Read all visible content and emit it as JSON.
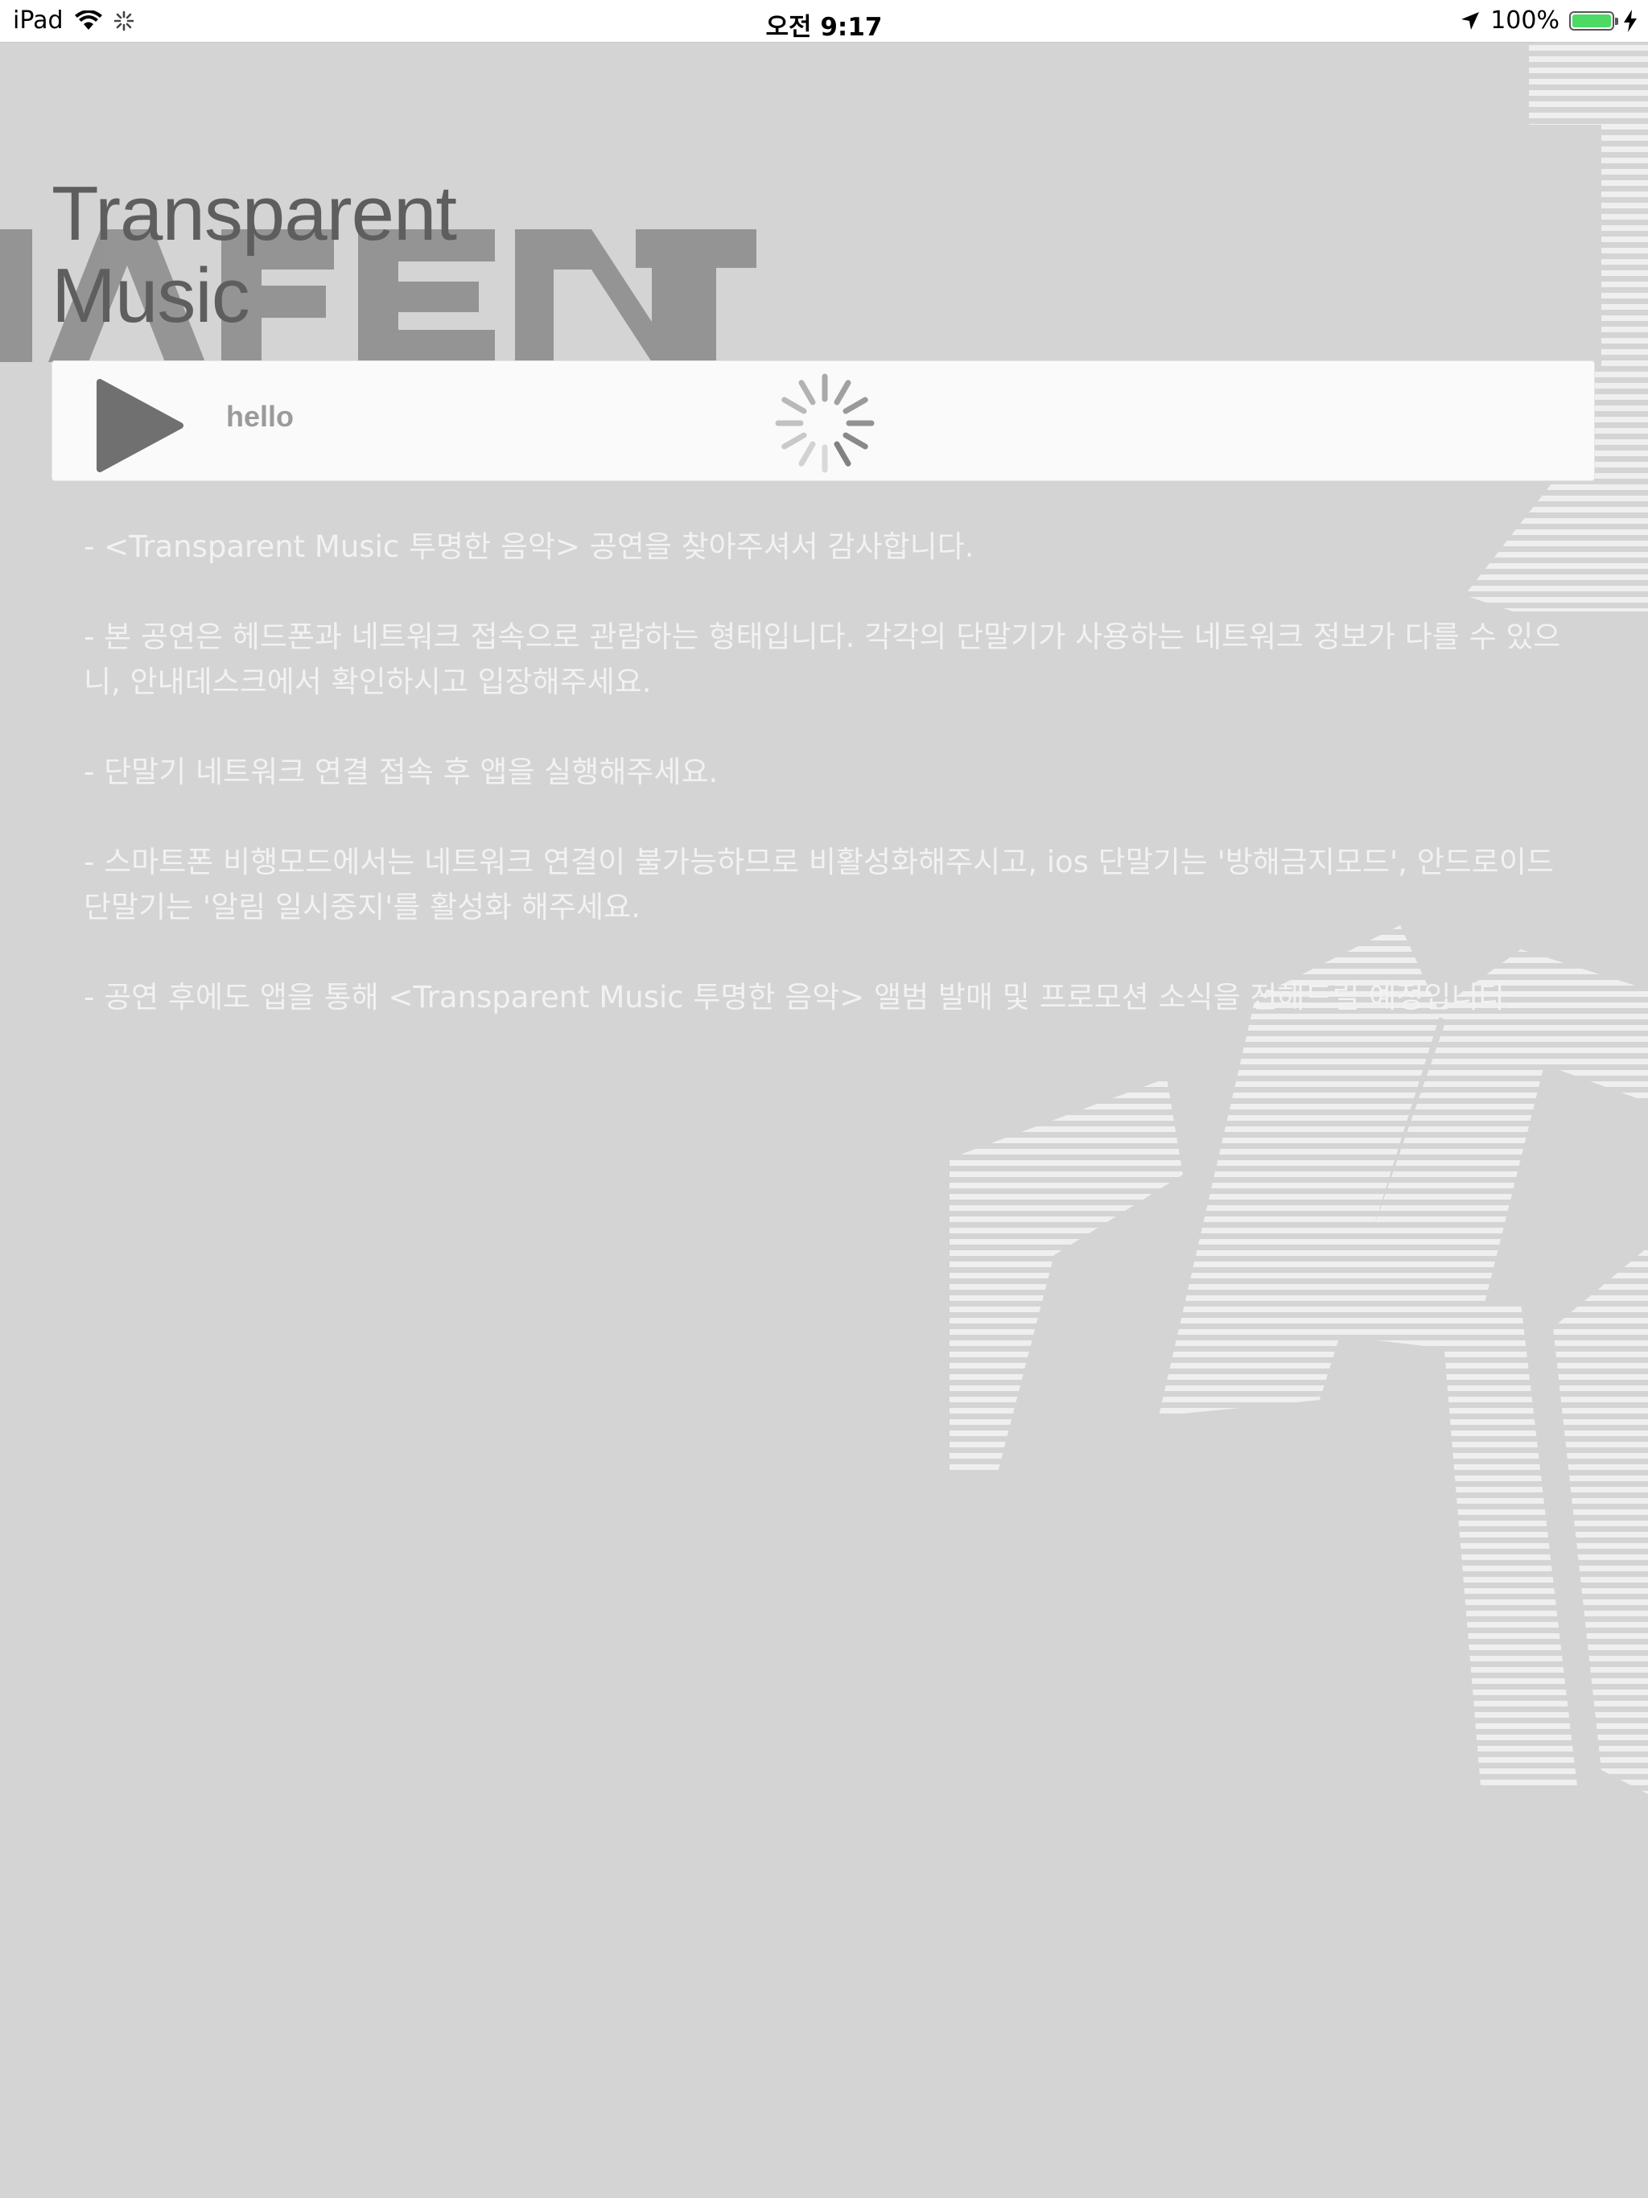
{
  "status_bar": {
    "device": "iPad",
    "time": "오전 9:17",
    "battery": "100%",
    "battery_level": 1.0
  },
  "app": {
    "title_line1": "Transparent",
    "title_line2": "Music"
  },
  "player": {
    "track_title": "hello",
    "play_icon": "play-icon",
    "loading_icon": "activity-spinner-icon"
  },
  "notice": [
    "- <Transparent Music 투명한 음악> 공연을 찾아주셔서 감사합니다.",
    "- 본 공연은 헤드폰과 네트워크 접속으로 관람하는 형태입니다. 각각의 단말기가 사용하는 네트워크 정보가 다를 수 있으니, 안내데스크에서 확인하시고 입장해주세요.",
    "- 단말기 네트워크 연결 접속 후 앱을 실행해주세요.",
    "- 스마트폰 비행모드에서는 네트워크 연결이 불가능하므로 비활성화해주시고, ios 단말기는 '방해금지모드', 안드로이드 단말기는 '알림 일시중지'를 활성화 해주세요.",
    "- 공연 후에도 앱을 통해 <Transparent Music 투명한 음악> 앨범 발매 및 프로모션 소식을 전해드릴 예정입니다."
  ],
  "colors": {
    "background": "#d4d4d4",
    "title": "#5e5e5e",
    "player_bg": "#fafafa",
    "notice_text": "#f2f2f2",
    "battery": "#4cd964"
  }
}
